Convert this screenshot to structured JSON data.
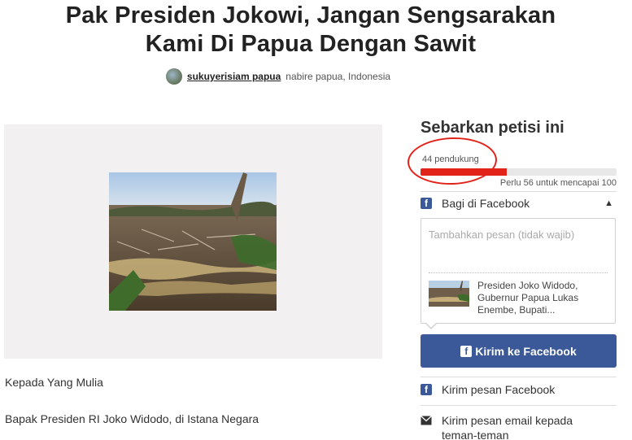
{
  "petition": {
    "title_line1": "Pak Presiden Jokowi, Jangan Sengsarakan",
    "title_line2": "Kami Di Papua Dengan Sawit",
    "author_name": "sukuyerisiam papua",
    "author_location": "nabire papua, Indonesia",
    "body_lines": [
      "Kepada Yang Mulia",
      "Bapak Presiden RI Joko Widodo, di Istana Negara"
    ]
  },
  "share_panel": {
    "heading": "Sebarkan petisi ini",
    "supporters_label": "44 pendukung",
    "progress_fraction": 0.44,
    "progress_note": "Perlu 56 untuk mencapai 100",
    "facebook_share_label": "Bagi di Facebook",
    "message_placeholder": "Tambahkan pesan (tidak wajib)",
    "preview_text": "Presiden Joko Widodo, Gubernur Papua Lukas Enembe, Bupati...",
    "facebook_send_label": "Kirim ke Facebook",
    "facebook_message_label": "Kirim pesan Facebook",
    "email_label": "Kirim pesan email kepada teman-teman"
  },
  "icons": {
    "facebook": "facebook-icon",
    "chevron": "chevron-up-icon",
    "email": "envelope-icon"
  },
  "colors": {
    "accent_red": "#e2231a",
    "facebook_blue": "#3b5998"
  }
}
